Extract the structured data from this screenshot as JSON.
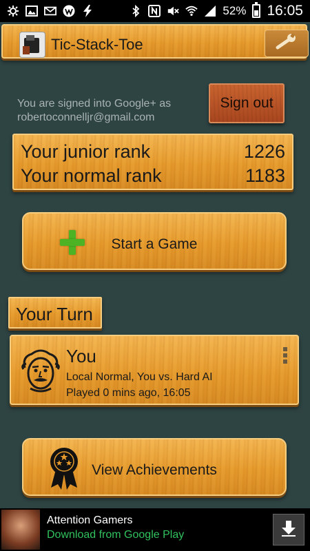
{
  "status_bar": {
    "battery_percent": "52%",
    "time": "16:05",
    "icons": [
      "settings-icon",
      "image-icon",
      "gmail-icon",
      "w-app-icon",
      "flash-icon",
      "bluetooth-icon",
      "nfc-icon",
      "mute-icon",
      "wifi-icon",
      "signal-icon",
      "battery-icon"
    ]
  },
  "app_bar": {
    "title": "Tic-Stack-Toe",
    "app_icon": "app-logo-icon",
    "settings_icon": "wrench-icon"
  },
  "account": {
    "signed_in_text": "You are signed into Google+ as",
    "email": "robertoconnelljr@gmail.com",
    "sign_out_label": "Sign out"
  },
  "ranks": [
    {
      "label": "Your junior rank",
      "value": "1226"
    },
    {
      "label": "Your normal rank",
      "value": "1183"
    }
  ],
  "start_game": {
    "label": "Start a Game",
    "icon": "plus-icon"
  },
  "your_turn": {
    "label": "Your Turn"
  },
  "game_card": {
    "player": "You",
    "mode_line": "Local Normal, You vs. Hard AI",
    "played_line": "Played 0 mins ago, 16:05",
    "avatar_icon": "einstein-avatar-icon",
    "menu_icon": "overflow-menu-icon"
  },
  "achievements": {
    "label": "View Achievements",
    "icon": "award-ribbon-icon"
  },
  "ad": {
    "title": "Attention Gamers",
    "subtitle": "Download from Google Play",
    "download_icon": "download-arrow-icon"
  },
  "colors": {
    "background": "#2e4443",
    "wood": "#e69a2c",
    "sign_out": "#b8512a",
    "ad_link": "#31c25e"
  }
}
